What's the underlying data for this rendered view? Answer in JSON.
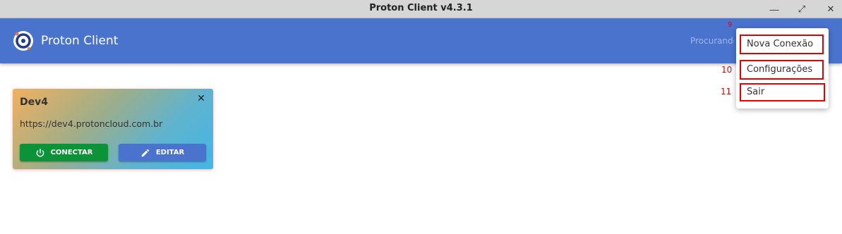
{
  "window": {
    "title": "Proton Client v4.3.1",
    "minimize_glyph": "—",
    "maximize_glyph": "⤢",
    "close_glyph": "✕"
  },
  "appbar": {
    "title": "Proton Client",
    "status": "Procurando"
  },
  "connection_card": {
    "name": "Dev4",
    "url": "https://dev4.protoncloud.com.br",
    "close_glyph": "✕",
    "connect_label": "CONECTAR",
    "edit_label": "EDITAR"
  },
  "menu": {
    "items": [
      {
        "label": "Nova Conexão"
      },
      {
        "label": "Configurações"
      },
      {
        "label": "Sair"
      }
    ]
  },
  "annotations": {
    "markers": [
      "9",
      "10",
      "11"
    ]
  },
  "colors": {
    "appbar": "#4a73ce",
    "connect_button": "#0c9339",
    "edit_button": "#4a73ce",
    "highlight": "#e10000"
  },
  "icons": {
    "logo": "proton-logo-icon",
    "connect": "power-icon",
    "edit": "pencil-icon"
  }
}
